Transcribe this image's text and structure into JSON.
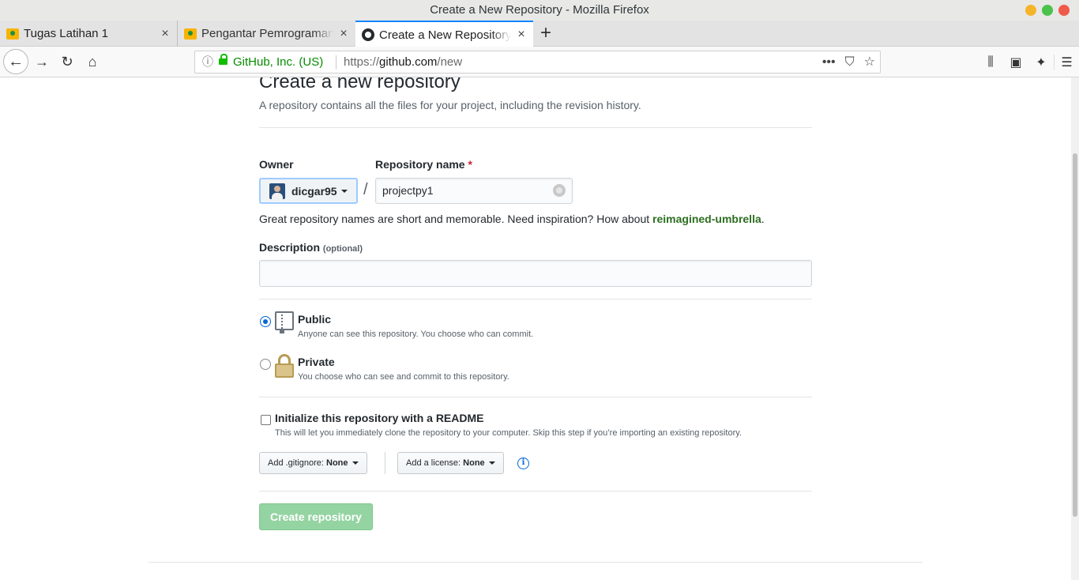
{
  "window": {
    "title": "Create a New Repository - Mozilla Firefox"
  },
  "tabs": [
    {
      "title": "Tugas Latihan 1",
      "close": "×"
    },
    {
      "title": "Pengantar Pemrograman",
      "close": "×"
    },
    {
      "title": "Create a New Repository",
      "close": "×"
    }
  ],
  "new_tab": "+",
  "urlbar": {
    "info": "ⓘ",
    "org": "GitHub, Inc. (US)",
    "url_prefix": "https://",
    "url_host": "github.com",
    "url_path": "/new",
    "more": "•••",
    "pocket": "⛉",
    "bookmark": "☆"
  },
  "toolbar": {
    "library": "⫼",
    "sidebar": "▣",
    "extension": "✦",
    "menu": "☰"
  },
  "page": {
    "heading": "Create a new repository",
    "lead": "A repository contains all the files for your project, including the revision history.",
    "owner_label": "Owner",
    "owner": "dicgar95",
    "repo_name_label": "Repository name",
    "required_mark": "*",
    "slash": "/",
    "repo_name_value": "projectpy1",
    "hint_text": "Great repository names are short and memorable. Need inspiration? How about ",
    "hint_suggestion": "reimagined-umbrella",
    "hint_end": ".",
    "description_label": "Description",
    "description_optional": "(optional)",
    "description_value": "",
    "public_title": "Public",
    "public_note": "Anyone can see this repository. You choose who can commit.",
    "private_title": "Private",
    "private_note": "You choose who can see and commit to this repository.",
    "init_title": "Initialize this repository with a README",
    "init_note": "This will let you immediately clone the repository to your computer. Skip this step if you’re importing an existing repository.",
    "gitignore_label": "Add .gitignore:",
    "gitignore_value": "None",
    "license_label": "Add a license:",
    "license_value": "None",
    "info": "i",
    "create_button": "Create repository"
  },
  "colors": {
    "accent": "#0366d6",
    "create_button": "#94d3a2",
    "suggestion": "#2c6e20",
    "secure": "#058b00"
  }
}
